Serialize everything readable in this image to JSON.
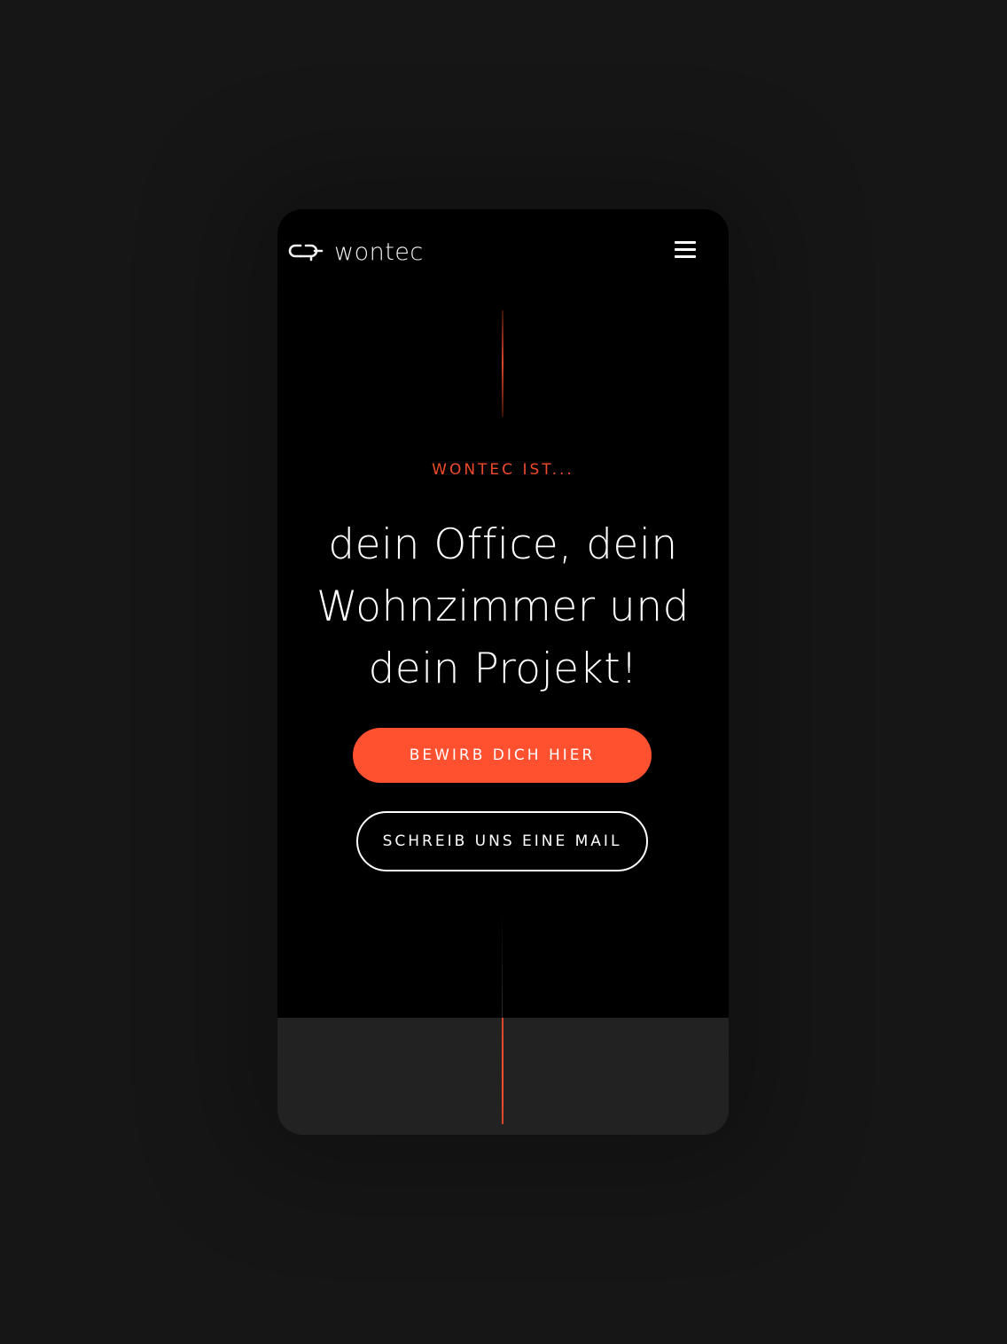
{
  "brand": {
    "name": "wontec",
    "logo_mark_icon": "wontec-chain-logo-icon"
  },
  "header": {
    "menu_icon": "hamburger-menu-icon"
  },
  "hero": {
    "eyebrow": "WONTEC IST...",
    "headline_line1": "dein Office, dein",
    "headline_line2": "Wohnzimmer und",
    "headline_line3": "dein Projekt!",
    "primary_cta": "BEWIRB DICH HIER",
    "secondary_cta": "SCHREIB UNS EINE MAIL"
  },
  "colors": {
    "accent": "#ff5030",
    "background": "#000000",
    "page_background": "#161616",
    "panel": "#222222",
    "text": "#ffffff"
  }
}
